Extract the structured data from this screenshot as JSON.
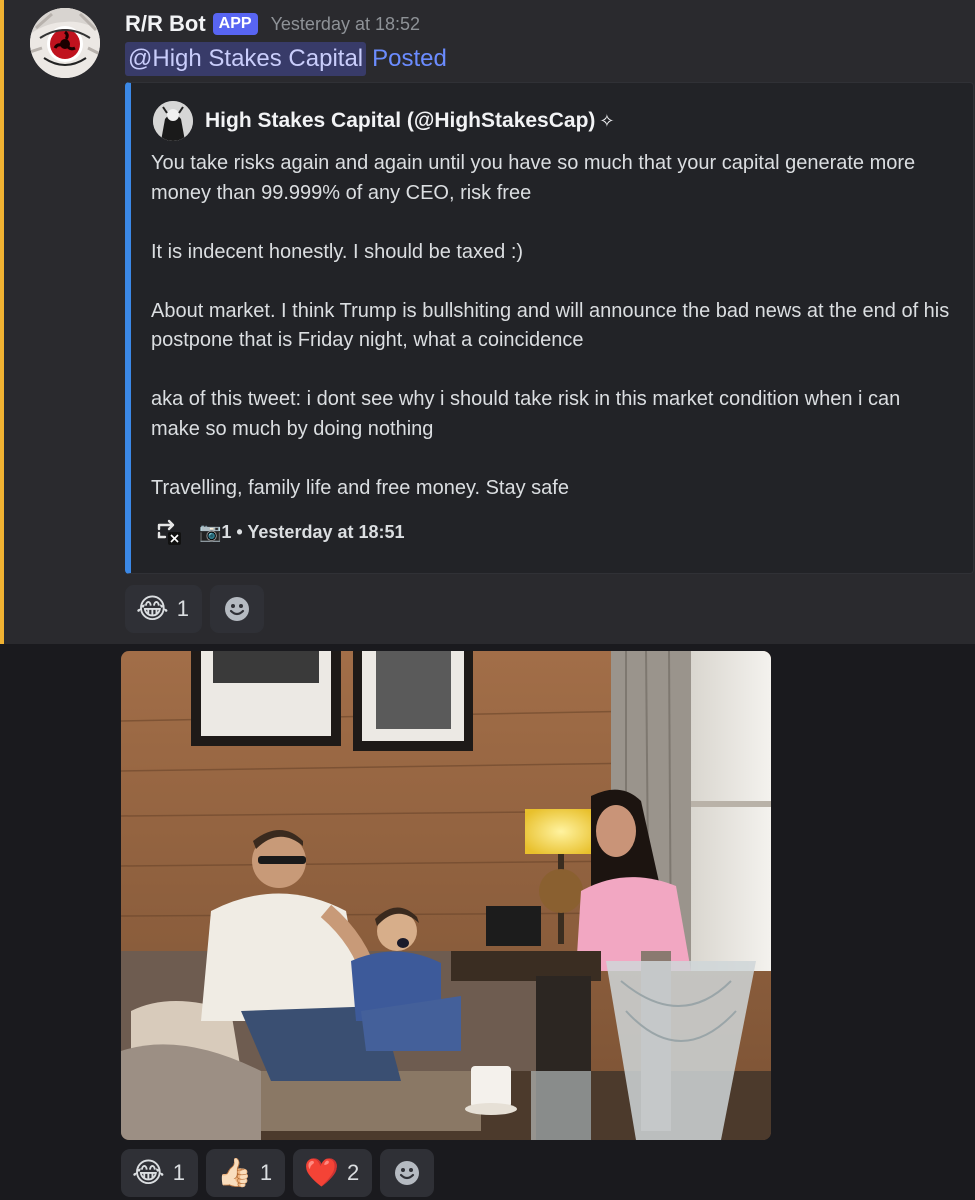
{
  "message1": {
    "username": "R/R Bot",
    "app_badge": "APP",
    "timestamp": "Yesterday at 18:52",
    "mention": "@High Stakes Capital",
    "posted": "Posted",
    "embed": {
      "author": "High Stakes Capital (@HighStakesCap)",
      "author_suffix": "✧",
      "paragraphs": [
        "You take risks again and again until you have so much that your capital generate more money than 99.999% of any CEO, risk free",
        "It is indecent honestly. I should be taxed :)",
        "About market. I think Trump is bullshiting and will announce the bad news at the end of his postpone that is Friday night, what a coincidence",
        "aka of this tweet: i dont see why i should take risk in this market condition when i can make so much by doing nothing",
        "Travelling, family life and free money. Stay safe"
      ],
      "footer": "📷1 • Yesterday at 18:51"
    },
    "reactions": [
      {
        "emoji": "😂",
        "count": "1"
      }
    ]
  },
  "message2": {
    "reactions": [
      {
        "emoji": "😂",
        "count": "1"
      },
      {
        "emoji": "👍🏻",
        "count": "1"
      },
      {
        "emoji": "❤️",
        "count": "2"
      }
    ]
  },
  "colors": {
    "accent_bar": "#f0b232",
    "embed_border": "#3b88e6",
    "app_badge": "#5865f2",
    "posted_link": "#6b8cff"
  },
  "icons": [
    "repost-x-icon",
    "add-reaction-icon"
  ]
}
